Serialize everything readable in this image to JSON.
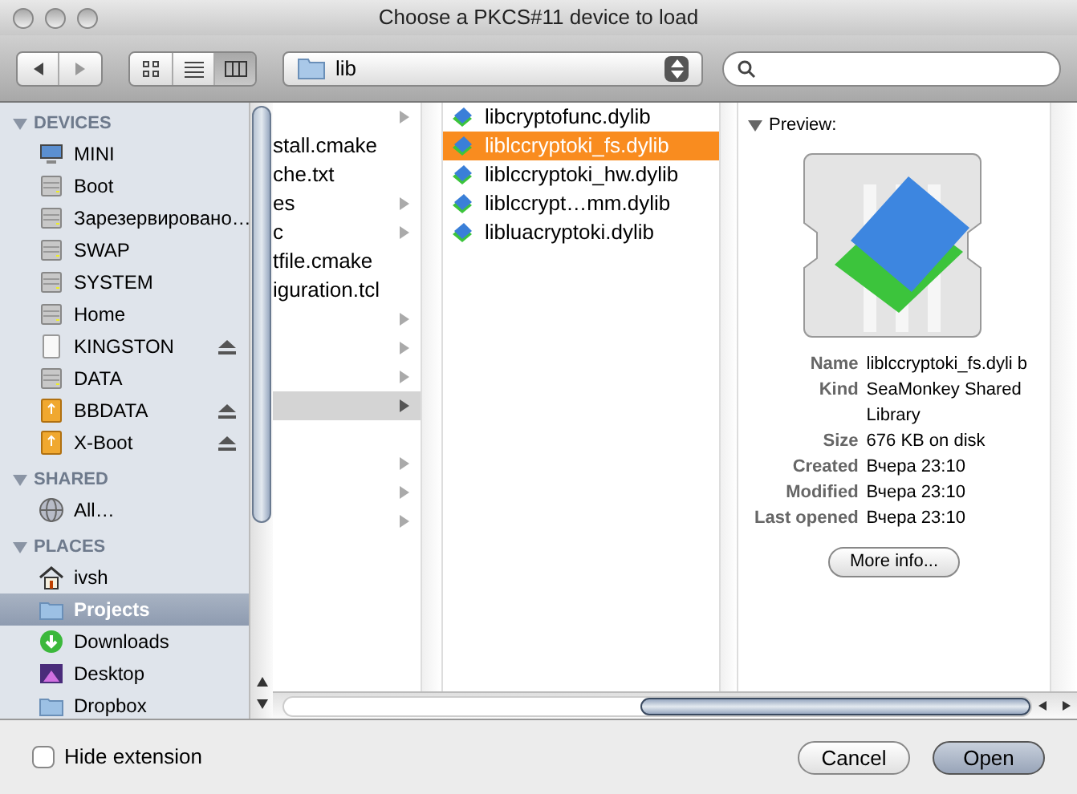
{
  "window": {
    "title": "Choose a PKCS#11 device to load"
  },
  "toolbar": {
    "views": [
      {
        "kind": "icons",
        "selected": false
      },
      {
        "kind": "list",
        "selected": false
      },
      {
        "kind": "columns",
        "selected": true
      }
    ],
    "location": "lib"
  },
  "sidebar": [
    {
      "title": "DEVICES",
      "expanded": true,
      "items": [
        {
          "label": "MINI",
          "kind": "computer",
          "eject": false,
          "selected": false
        },
        {
          "label": "Boot",
          "kind": "disk",
          "eject": false,
          "selected": false
        },
        {
          "label": "Зарезервировано…",
          "kind": "disk",
          "eject": false,
          "selected": false
        },
        {
          "label": "SWAP",
          "kind": "disk",
          "eject": false,
          "selected": false
        },
        {
          "label": "SYSTEM",
          "kind": "disk",
          "eject": false,
          "selected": false
        },
        {
          "label": "Home",
          "kind": "disk",
          "eject": false,
          "selected": false
        },
        {
          "label": "KINGSTON",
          "kind": "removable",
          "eject": true,
          "selected": false
        },
        {
          "label": "DATA",
          "kind": "disk",
          "eject": false,
          "selected": false
        },
        {
          "label": "BBDATA",
          "kind": "usb",
          "eject": true,
          "selected": false
        },
        {
          "label": "X-Boot",
          "kind": "usb",
          "eject": true,
          "selected": false
        }
      ]
    },
    {
      "title": "SHARED",
      "expanded": true,
      "items": [
        {
          "label": "All…",
          "kind": "network",
          "eject": false,
          "selected": false
        }
      ]
    },
    {
      "title": "PLACES",
      "expanded": true,
      "items": [
        {
          "label": "ivsh",
          "kind": "home",
          "eject": false,
          "selected": false
        },
        {
          "label": "Projects",
          "kind": "folder",
          "eject": false,
          "selected": true
        },
        {
          "label": "Downloads",
          "kind": "downloads",
          "eject": false,
          "selected": false
        },
        {
          "label": "Desktop",
          "kind": "desktop",
          "eject": false,
          "selected": false
        },
        {
          "label": "Dropbox",
          "kind": "folder",
          "eject": false,
          "selected": false
        }
      ]
    }
  ],
  "column_1": [
    {
      "folder": true,
      "selected": false
    },
    {
      "name": "stall.cmake",
      "folder": false,
      "selected": false
    },
    {
      "name": "che.txt",
      "folder": false,
      "selected": false
    },
    {
      "name": "es",
      "folder": true,
      "selected": false
    },
    {
      "name": "c",
      "folder": true,
      "selected": false
    },
    {
      "name": "tfile.cmake",
      "folder": false,
      "selected": false
    },
    {
      "name": "iguration.tcl",
      "folder": false,
      "selected": false
    },
    {
      "folder": true,
      "selected": false
    },
    {
      "folder": true,
      "selected": false
    },
    {
      "folder": true,
      "selected": false
    },
    {
      "folder": true,
      "selected": true
    },
    {
      "folder": false,
      "selected": false
    },
    {
      "folder": true,
      "selected": false
    },
    {
      "folder": true,
      "selected": false
    },
    {
      "folder": true,
      "selected": false
    }
  ],
  "column_2": [
    {
      "name": "libcryptofunc.dylib",
      "selected": false
    },
    {
      "name": "liblccryptoki_fs.dylib",
      "selected": true
    },
    {
      "name": "liblccryptoki_hw.dylib",
      "selected": false
    },
    {
      "name": "liblccrypt…mm.dylib",
      "selected": false
    },
    {
      "name": "libluacryptoki.dylib",
      "selected": false
    }
  ],
  "preview": {
    "title": "Preview:",
    "fields": [
      {
        "label": "Name",
        "value": "liblccryptoki_fs.dyli b"
      },
      {
        "label": "Kind",
        "value": "SeaMonkey Shared Library"
      },
      {
        "label": "Size",
        "value": "676 KB on disk"
      },
      {
        "label": "Created",
        "value": "Вчера 23:10"
      },
      {
        "label": "Modified",
        "value": "Вчера 23:10"
      },
      {
        "label": "Last opened",
        "value": "Вчера 23:10"
      }
    ],
    "button": "More info..."
  },
  "hide_extension": {
    "label": "Hide extension",
    "checked": false
  },
  "buttons": [
    {
      "label": "Cancel",
      "default": false
    },
    {
      "label": "Open",
      "default": true
    }
  ]
}
